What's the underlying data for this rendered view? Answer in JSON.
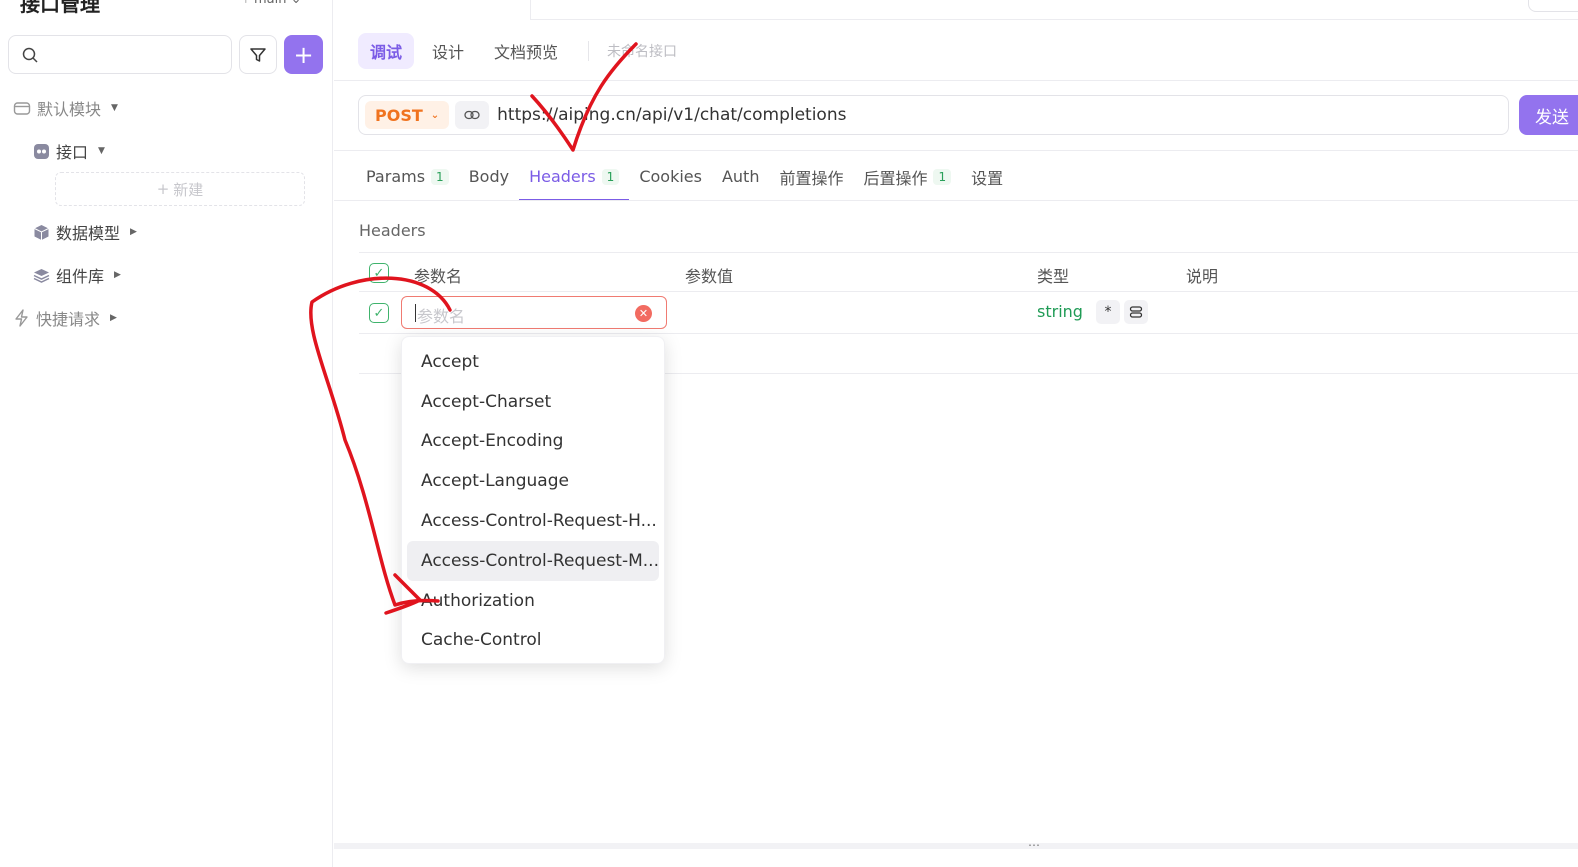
{
  "sidebar": {
    "title": "接口管理",
    "branch": "main",
    "add_label": "+",
    "tree": {
      "default_module": "默认模块",
      "interfaces": "接口",
      "new_label": "新建",
      "data_models": "数据模型",
      "components": "组件库",
      "quick_requests": "快捷请求"
    }
  },
  "main": {
    "mode_tabs": [
      "调试",
      "设计",
      "文档预览"
    ],
    "api_name": "未命名接口",
    "method": "POST",
    "url": "https://aiping.cn/api/v1/chat/completions",
    "send_label": "发送",
    "request_tabs": [
      {
        "label": "Params",
        "badge": "1"
      },
      {
        "label": "Body",
        "badge": ""
      },
      {
        "label": "Headers",
        "badge": "1"
      },
      {
        "label": "Cookies",
        "badge": ""
      },
      {
        "label": "Auth",
        "badge": ""
      },
      {
        "label": "前置操作",
        "badge": ""
      },
      {
        "label": "后置操作",
        "badge": "1"
      },
      {
        "label": "设置",
        "badge": ""
      }
    ],
    "active_request_tab": "Headers",
    "section_title": "Headers",
    "columns": [
      "参数名",
      "参数值",
      "类型",
      "说明"
    ],
    "row": {
      "name_placeholder": "参数名",
      "type": "string",
      "required_symbol": "*"
    },
    "suggestions": [
      "Accept",
      "Accept-Charset",
      "Accept-Encoding",
      "Accept-Language",
      "Access-Control-Request-H...",
      "Access-Control-Request-M...",
      "Authorization",
      "Cache-Control"
    ],
    "hovered_suggestion": "Access-Control-Request-M...",
    "bottom_grip": "⋯"
  },
  "colors": {
    "accent": "#9373ee",
    "method": "#f0731f",
    "success": "#3fb36c",
    "annotation": "#e0141e"
  }
}
